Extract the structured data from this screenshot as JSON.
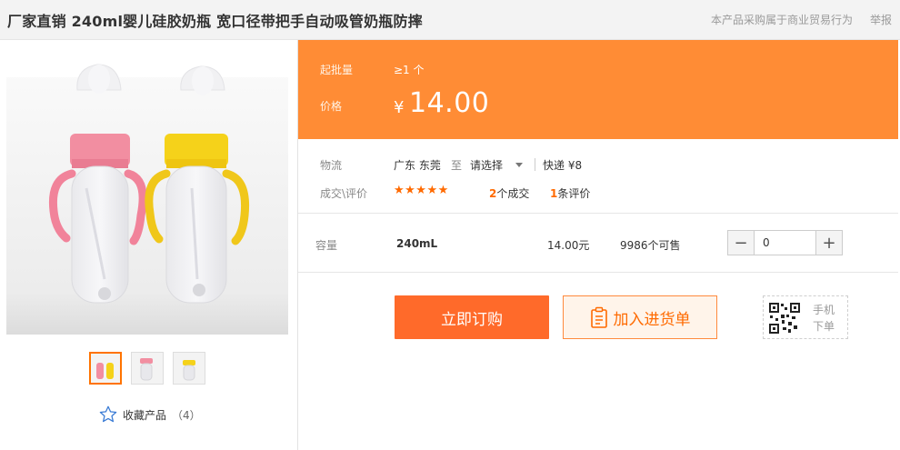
{
  "header": {
    "title": "厂家直销 240ml婴儿硅胶奶瓶 宽口径带把手自动吸管奶瓶防摔",
    "note": "本产品采购属于商业贸易行为",
    "report": "举报"
  },
  "gallery": {
    "favorite_label": "收藏产品",
    "favorite_count": "（4）"
  },
  "price": {
    "moq_label": "起批量",
    "moq_value": "≥1 个",
    "price_label": "价格",
    "currency": "¥",
    "amount": "14.00",
    "bg_color": "#ff8c35"
  },
  "logistics": {
    "label": "物流",
    "from": "广东 东莞",
    "to_word": "至",
    "region_select": "请选择",
    "shipping": "快递 ¥8"
  },
  "reviews": {
    "label": "成交\\评价",
    "stars": "★★★★★",
    "rating": 5,
    "deals_count": "2",
    "deals_label": "个成交",
    "reviews_count": "1",
    "reviews_label": "条评价"
  },
  "spec": {
    "label": "容量",
    "value": "240mL",
    "price": "14.00元",
    "stock": "9986个可售",
    "quantity": "0",
    "minus": "−",
    "plus": "+"
  },
  "actions": {
    "buy_label": "立即订购",
    "cart_label": "加入进货单",
    "mobile_label": "手机下单",
    "accent": "#ff6a2a"
  }
}
